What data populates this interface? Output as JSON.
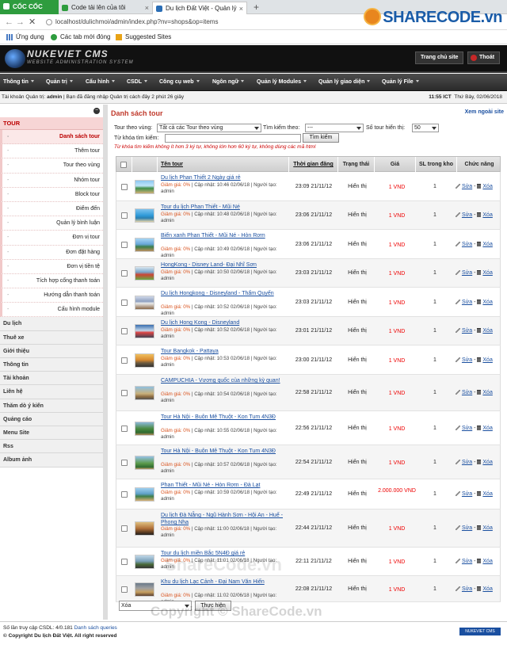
{
  "browser": {
    "brand": "CỐC CỐC",
    "tabs": [
      {
        "title": "Code tải lên của tôi"
      },
      {
        "title": "Du lịch Đất Việt - Quản lý"
      }
    ],
    "new_tab": "+",
    "close": "×",
    "url": "localhost/dulichmoi/admin/index.php?nv=shops&op=items",
    "bookmarks": [
      "Ứng dụng",
      "Các tab mới đóng",
      "Suggested Sites"
    ],
    "nav": {
      "back": "←",
      "forward": "→",
      "reload": "✕",
      "home": "⌂"
    }
  },
  "watermark_logo": {
    "share": "SHARE",
    "code": "CODE.vn"
  },
  "header": {
    "logo_title": "NUKEVIET CMS",
    "logo_sub": "WEBSITE ADMINISTRATION SYSTEM",
    "btn_home": "Trang chủ site",
    "btn_logout": "Thoát"
  },
  "topmenu": [
    "Thông tin",
    "Quản trị",
    "Cấu hình",
    "CSDL",
    "Công cụ web",
    "Ngôn ngữ",
    "Quản lý Modules",
    "Quản lý giao diện",
    "Quản lý File"
  ],
  "infobar": {
    "left_prefix": "Tài khoản Quản trị: ",
    "user": "admin",
    "left_suffix": " | Bạn đã đăng nhập Quản trị cách đây 2 phút 26 giây",
    "time": "11:55 ICT",
    "date": "Thứ Bảy, 02/06/2018"
  },
  "sidebar": {
    "toggle": "−",
    "section": "TOUR",
    "subitems": [
      "Danh sách tour",
      "Thêm tour",
      "Tour theo vùng",
      "Nhóm tour",
      "Block tour",
      "Điểm đến",
      "Quản lý bình luận",
      "Đơn vị tour",
      "Đơn đặt hàng",
      "Đơn vị tiền tệ",
      "Tích hợp cổng thanh toán",
      "Hướng dẫn thanh toán",
      "Cấu hình module"
    ],
    "items": [
      "Du lịch",
      "Thuê xe",
      "Giới thiệu",
      "Thông tin",
      "Tài khoản",
      "Liên hệ",
      "Thăm dò ý kiến",
      "Quảng cáo",
      "Menu Site",
      "Rss",
      "Album ảnh"
    ]
  },
  "content": {
    "title": "Danh sách tour",
    "external_link": "Xem ngoài site",
    "filter": {
      "region_label": "Tour theo vùng:",
      "region_value": "Tất cả các Tour theo vùng",
      "search_by_label": "Tìm kiếm theo:",
      "search_by_value": "---",
      "per_page_label": "Số tour hiển thị:",
      "per_page_value": "50",
      "keyword_label": "Từ khóa tìm kiếm:",
      "keyword_value": "",
      "search_button": "Tìm kiếm",
      "hint": "Từ khóa tìm kiếm không ít hơn 3 ký tự, không lớn hơn 60 ký tự, không dùng các mã html"
    },
    "table": {
      "headers": [
        "Tên tour",
        "Thời gian đăng",
        "Trạng thái",
        "Giá",
        "SL trong kho",
        "Chức năng"
      ],
      "meta_discount": "Giảm giá: 0%",
      "meta_by": "Người tạo: admin",
      "edit": "Sửa",
      "delete": "Xóa",
      "rows": [
        {
          "name": "Du lịch Phan Thiết 2 Ngày giá rẻ",
          "updated": "Cập nhật: 10:46 02/06/18",
          "time": "23:09 21/11/12",
          "status": "Hiển thị",
          "price": "1 VND",
          "stock": "1"
        },
        {
          "name": "Tour du lịch Phan Thiết - Mũi Né",
          "updated": "Cập nhật: 10:48 02/06/18",
          "time": "23:06 21/11/12",
          "status": "Hiển thị",
          "price": "1 VND",
          "stock": "1"
        },
        {
          "name": "Biển xanh Phan Thiết - Mũi Né - Hòn Rơm",
          "updated": "Cập nhật: 10:49 02/06/18",
          "time": "23:06 21/11/12",
          "status": "Hiển thị",
          "price": "1 VND",
          "stock": "1"
        },
        {
          "name": "HongKong - Disney Land- Đại Nhĩ Sơn",
          "updated": "Cập nhật: 10:50 02/06/18",
          "time": "23:03 21/11/12",
          "status": "Hiển thị",
          "price": "1 VND",
          "stock": "1"
        },
        {
          "name": "Du lịch Hongkong - Disneyland - Thẩm Quyến",
          "updated": "Cập nhật: 10:52 02/06/18",
          "time": "23:03 21/11/12",
          "status": "Hiển thị",
          "price": "1 VND",
          "stock": "1"
        },
        {
          "name": "Du lịch Hong Kong - Disneyland",
          "updated": "Cập nhật: 10:52 02/06/18",
          "time": "23:01 21/11/12",
          "status": "Hiển thị",
          "price": "1 VND",
          "stock": "1"
        },
        {
          "name": "Tour Bangkok - Pattaya",
          "updated": "Cập nhật: 10:53 02/06/18",
          "time": "23:00 21/11/12",
          "status": "Hiển thị",
          "price": "1 VND",
          "stock": "1"
        },
        {
          "name": "CAMPUCHIA - Vương quốc của những kỳ quan!",
          "updated": "Cập nhật: 10:54 02/06/18",
          "time": "22:58 21/11/12",
          "status": "Hiển thị",
          "price": "1 VND",
          "stock": "1"
        },
        {
          "name": "Tour Hà Nội - Buôn Mê Thuột - Kon Tum 4N3Đ",
          "updated": "Cập nhật: 10:55 02/06/18",
          "time": "22:56 21/11/12",
          "status": "Hiển thị",
          "price": "1 VND",
          "stock": "1"
        },
        {
          "name": "Tour Hà Nội - Buôn Mê Thuột - Kon Tum 4N3Đ",
          "updated": "Cập nhật: 10:57 02/06/18",
          "time": "22:54 21/11/12",
          "status": "Hiển thị",
          "price": "1 VND",
          "stock": "1"
        },
        {
          "name": "Phan Thiết - Mũi Né - Hòn Rơm - Đà Lạt",
          "updated": "Cập nhật: 10:59 02/06/18",
          "time": "22:49 21/11/12",
          "status": "Hiển thị",
          "price": "2.000.000 VND",
          "stock": "1"
        },
        {
          "name": "Du lịch Đà Nẵng - Ngũ Hành Sơn - Hội An - Huế - Phong Nha",
          "updated": "Cập nhật: 11:00 02/06/18",
          "time": "22:44 21/11/12",
          "status": "Hiển thị",
          "price": "1 VND",
          "stock": "1"
        },
        {
          "name": "Tour du lịch miền Bắc 5N4Đ giá rẻ",
          "updated": "Cập nhật: 11:01 02/06/18",
          "time": "22:11 21/11/12",
          "status": "Hiển thị",
          "price": "1 VND",
          "stock": "1"
        },
        {
          "name": "Khu du lịch Lạc Cảnh - Đại Nam Văn Hiến",
          "updated": "Cập nhật: 11:02 02/06/18",
          "time": "22:08 21/11/12",
          "status": "Hiển thị",
          "price": "1 VND",
          "stock": "1"
        }
      ]
    },
    "bulk": {
      "action": "Xóa",
      "button": "Thực hiện"
    }
  },
  "footer": {
    "queries_prefix": "Số lần truy cập CSDL: 4/0.181 ",
    "queries_link": "Danh sách queries",
    "copyright": "© Copyright Du lịch Đất Việt. All right reserved",
    "badge": "NUKEVIET CMS"
  },
  "watermark": "Copyright © ShareCode.vn",
  "watermark2": "ShareCode.vn"
}
